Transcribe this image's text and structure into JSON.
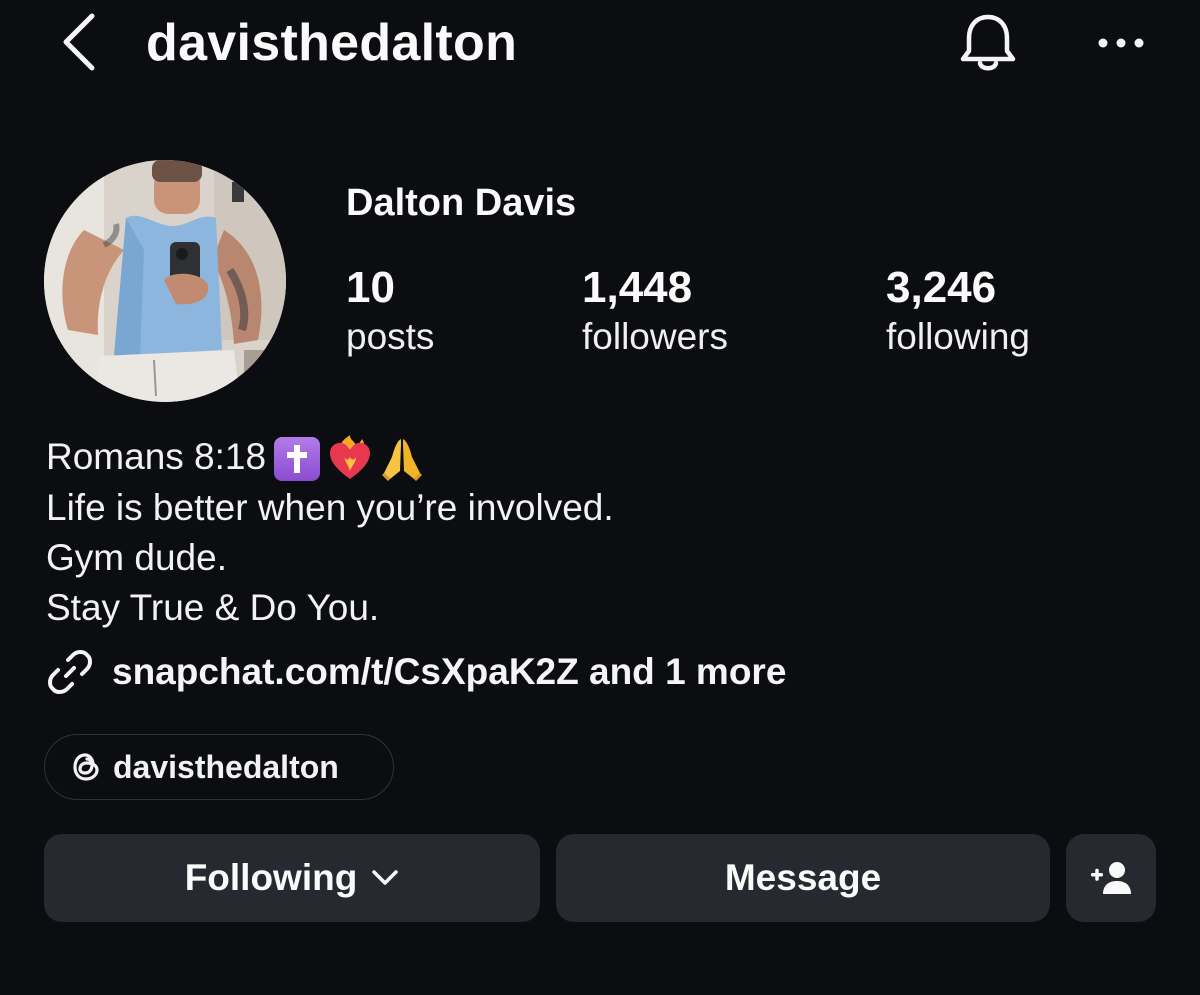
{
  "header": {
    "username": "davisthedalton",
    "back_icon": "chevron-left-icon",
    "bell_icon": "bell-icon",
    "more_icon": "more-horizontal-icon"
  },
  "profile": {
    "display_name": "Dalton Davis",
    "avatar_icon": "profile-photo",
    "stats": {
      "posts": {
        "value": "10",
        "label": "posts"
      },
      "followers": {
        "value": "1,448",
        "label": "followers"
      },
      "following": {
        "value": "3,246",
        "label": "following"
      }
    }
  },
  "bio": {
    "line1": "Romans 8:18",
    "line1_emojis": [
      "latin-cross-emoji",
      "heart-on-fire-emoji",
      "folded-hands-emoji"
    ],
    "line2": "Life is better when you’re involved.",
    "line3": "Gym dude.",
    "line4": "Stay True & Do You."
  },
  "link": {
    "icon": "link-icon",
    "text": "snapchat.com/t/CsXpaK2Z and 1 more"
  },
  "threads": {
    "icon": "threads-icon",
    "handle": "davisthedalton"
  },
  "actions": {
    "following_label": "Following",
    "following_icon": "chevron-down-icon",
    "message_label": "Message",
    "add_user_icon": "add-user-icon"
  },
  "colors": {
    "background": "#0b0d10",
    "button_bg": "#262a30",
    "text": "#f5f5f5",
    "badge_border": "#2f3338"
  }
}
